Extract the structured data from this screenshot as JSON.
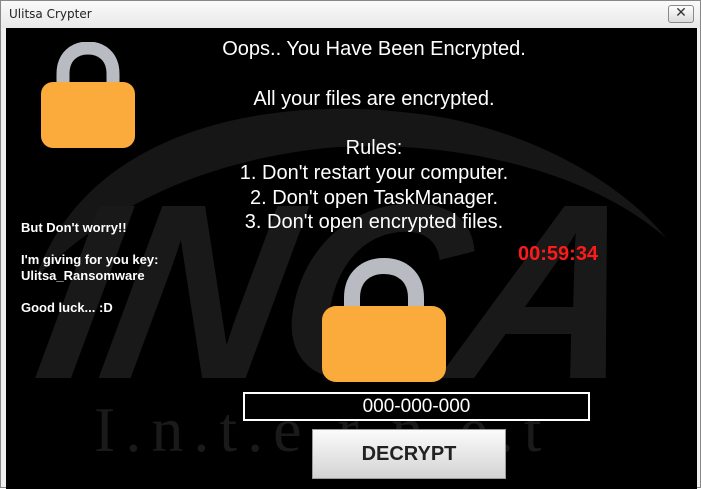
{
  "window": {
    "title": "Ulitsa Crypter",
    "close_glyph": "✕"
  },
  "main": {
    "heading": "Oops.. You Have Been Encrypted.",
    "subheading": "All your files are encrypted.",
    "rules_title": "Rules:",
    "rules": [
      "1. Don't restart your computer.",
      "2. Don't open TaskManager.",
      "3. Don't open encrypted files."
    ]
  },
  "side": {
    "line1": "But Don't worry!!",
    "line2": "I'm giving for you key:",
    "line3": "Ulitsa_Ransomware",
    "line4": "Good luck... :D"
  },
  "timer": {
    "value": "00:59:34",
    "color": "#ff1a1a"
  },
  "key_input": {
    "value": "000-000-000"
  },
  "decrypt_button": {
    "label": "DECRYPT"
  },
  "watermark": {
    "logo": "INCA",
    "subtext": "I.n.t.e.r.n.e.t"
  },
  "colors": {
    "lock_body": "#fbaa3c",
    "lock_shackle": "#b8bcc2",
    "background": "#000000"
  },
  "icons": [
    "lock-icon",
    "close-icon"
  ]
}
